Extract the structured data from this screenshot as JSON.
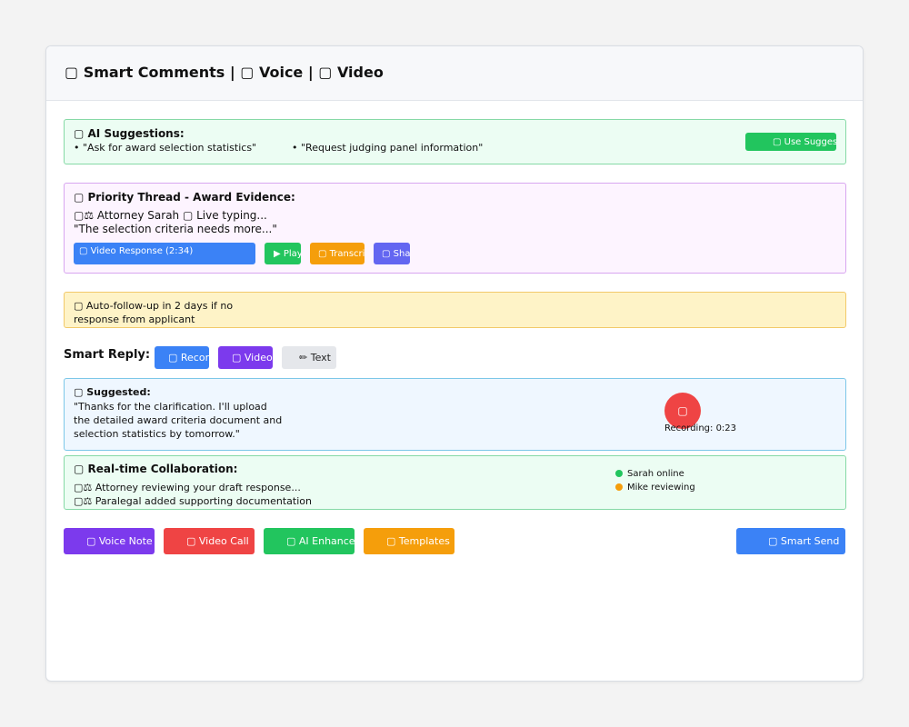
{
  "header": {
    "title": "▢ Smart Comments | ▢ Voice | ▢ Video"
  },
  "ai_suggestions": {
    "title": "▢ AI Suggestions:",
    "items": [
      "• \"Ask for award selection statistics\"",
      "• \"Request judging panel information\""
    ],
    "button": "▢ Use Suggestion"
  },
  "priority_thread": {
    "title": "▢ Priority Thread - Award Evidence:",
    "author_line": "▢⚖ Attorney Sarah ▢ Live typing...",
    "quote": "\"The selection criteria needs more...\"",
    "video_response": "▢ Video Response (2:34)",
    "play": "▶ Play",
    "transcript": "▢ Transcript",
    "share": "▢ Share"
  },
  "followup": {
    "line1": "▢ Auto-follow-up in 2 days if no",
    "line2": "response from applicant"
  },
  "smart_reply": {
    "label": "Smart Reply:",
    "record": "▢ Record",
    "video": "▢ Video",
    "text": "✏ Text"
  },
  "suggested": {
    "title": "▢ Suggested:",
    "lines": [
      "\"Thanks for the clarification. I'll upload",
      "the detailed award criteria document and",
      "selection statistics by tomorrow.\""
    ],
    "record_icon": "▢",
    "recording_status": "Recording: 0:23"
  },
  "collaboration": {
    "title": "▢ Real-time Collaboration:",
    "activity": [
      "▢⚖ Attorney reviewing your draft response...",
      "▢⚖ Paralegal added supporting documentation"
    ],
    "presence": [
      {
        "label": "Sarah online",
        "color": "#22c55e"
      },
      {
        "label": "Mike reviewing",
        "color": "#f59e0b"
      }
    ]
  },
  "actions": {
    "voice_note": "▢ Voice Note",
    "video_call": "▢ Video Call",
    "ai_enhance": "▢ AI Enhance",
    "templates": "▢ Templates",
    "smart_send": "▢ Smart Send"
  },
  "colors": {
    "green": "#22c55e",
    "purple": "#7c3aed",
    "blue": "#3b82f6",
    "orange": "#f59e0b",
    "red": "#ef4444",
    "indigo": "#6366f1"
  }
}
